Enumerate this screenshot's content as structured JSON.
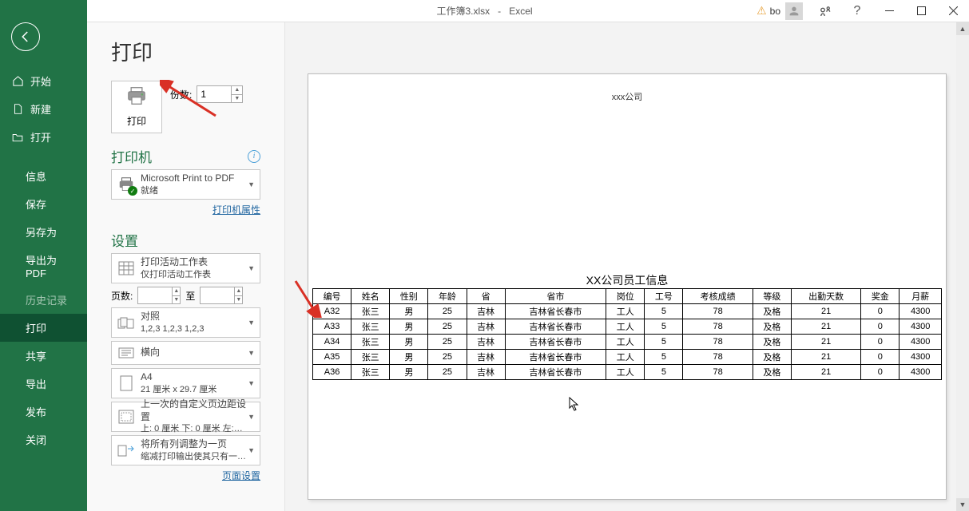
{
  "titlebar": {
    "filename": "工作簿3.xlsx",
    "appname": "Excel",
    "username": "bo"
  },
  "sidebar": {
    "items": [
      {
        "label": "开始",
        "icon": "home"
      },
      {
        "label": "新建",
        "icon": "new"
      },
      {
        "label": "打开",
        "icon": "open"
      }
    ],
    "sub_items": [
      {
        "label": "信息"
      },
      {
        "label": "保存"
      },
      {
        "label": "另存为"
      },
      {
        "label": "导出为PDF"
      },
      {
        "label": "历史记录",
        "disabled": true
      },
      {
        "label": "打印",
        "active": true
      },
      {
        "label": "共享"
      },
      {
        "label": "导出"
      },
      {
        "label": "发布"
      },
      {
        "label": "关闭"
      }
    ]
  },
  "print": {
    "page_title": "打印",
    "print_button": "打印",
    "copies_label": "份数:",
    "copies_value": "1",
    "printer_section": "打印机",
    "printer_name": "Microsoft Print to PDF",
    "printer_status": "就绪",
    "printer_props_link": "打印机属性",
    "settings_section": "设置",
    "setting_scope_line1": "打印活动工作表",
    "setting_scope_line2": "仅打印活动工作表",
    "pages_label": "页数:",
    "pages_to": "至",
    "collate_line1": "对照",
    "collate_line2": "1,2,3    1,2,3    1,2,3",
    "orientation": "横向",
    "paper_line1": "A4",
    "paper_line2": "21 厘米 x 29.7 厘米",
    "margins_line1": "上一次的自定义页边距设置",
    "margins_line2": "上: 0 厘米 下: 0 厘米 左:…",
    "scaling_line1": "将所有列调整为一页",
    "scaling_line2": "缩减打印输出使其只有一…",
    "page_setup_link": "页面设置"
  },
  "preview": {
    "company": "xxx公司",
    "table_caption": "XX公司员工信息"
  },
  "chart_data": {
    "type": "table",
    "title": "XX公司员工信息",
    "columns": [
      "编号",
      "姓名",
      "性别",
      "年龄",
      "省",
      "省市",
      "岗位",
      "工号",
      "考核成绩",
      "等级",
      "出勤天数",
      "奖金",
      "月薪"
    ],
    "rows": [
      [
        "A32",
        "张三",
        "男",
        "25",
        "吉林",
        "吉林省长春市",
        "工人",
        "5",
        "78",
        "及格",
        "21",
        "0",
        "4300"
      ],
      [
        "A33",
        "张三",
        "男",
        "25",
        "吉林",
        "吉林省长春市",
        "工人",
        "5",
        "78",
        "及格",
        "21",
        "0",
        "4300"
      ],
      [
        "A34",
        "张三",
        "男",
        "25",
        "吉林",
        "吉林省长春市",
        "工人",
        "5",
        "78",
        "及格",
        "21",
        "0",
        "4300"
      ],
      [
        "A35",
        "张三",
        "男",
        "25",
        "吉林",
        "吉林省长春市",
        "工人",
        "5",
        "78",
        "及格",
        "21",
        "0",
        "4300"
      ],
      [
        "A36",
        "张三",
        "男",
        "25",
        "吉林",
        "吉林省长春市",
        "工人",
        "5",
        "78",
        "及格",
        "21",
        "0",
        "4300"
      ]
    ]
  }
}
